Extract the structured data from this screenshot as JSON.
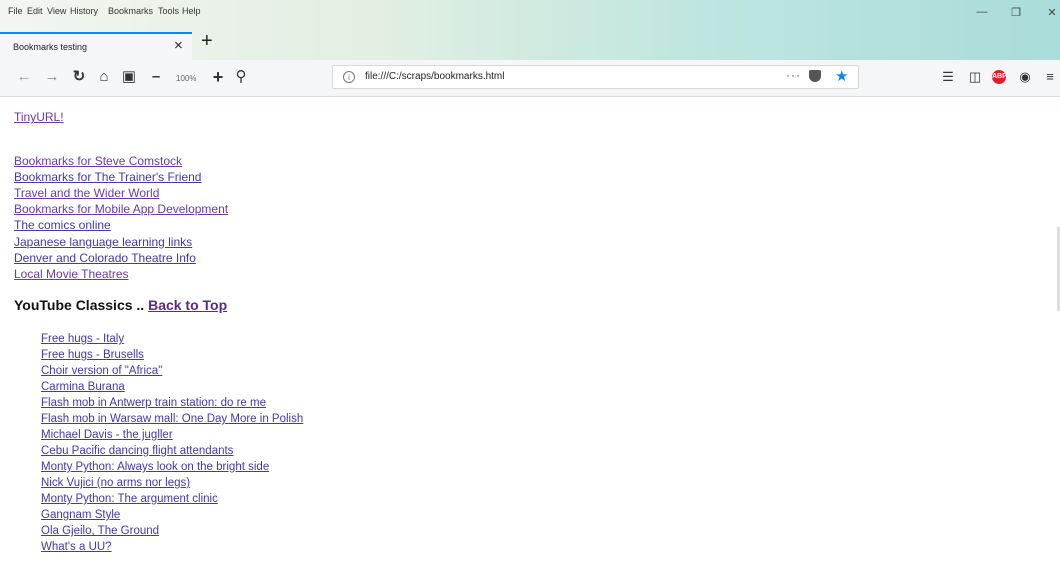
{
  "menu": [
    "File",
    "Edit",
    "View",
    "History",
    "Bookmarks",
    "Tools",
    "Help"
  ],
  "tab": {
    "title": "Bookmarks testing"
  },
  "nav": {
    "zoom": "100%",
    "url": "file:///C:/scraps/bookmarks.html",
    "more": "···"
  },
  "icons": {
    "back": "back-arrow-icon",
    "forward": "forward-arrow-icon",
    "reload": "reload-icon",
    "home": "home-icon",
    "screenshot": "screenshot-icon",
    "zoom_out": "zoom-out-icon",
    "zoom_in": "zoom-in-icon",
    "search": "search-icon",
    "library": "library-icon",
    "sidebar": "sidebar-icon",
    "abp": "adblock-icon",
    "addon": "addon-icon",
    "menu": "hamburger-menu-icon"
  },
  "colors": {
    "link": "#4338ad",
    "visited": "#6b3aa6",
    "star": "#0a84ff",
    "abp": "#e11d2b"
  },
  "page": {
    "tinyurl": "TinyURL!",
    "bookmark_links": [
      "Bookmarks for Steve Comstock",
      "Bookmarks for The Trainer's Friend",
      "Travel and the Wider World",
      "Bookmarks for Mobile App Development",
      "The comics online",
      "Japanese language learning links",
      "Denver and Colorado Theatre Info",
      "Local Movie Theatres"
    ],
    "section_title": "YouTube Classics ..",
    "back_to_top": "Back to Top",
    "youtube_links": [
      "Free hugs - Italy",
      "Free hugs - Brusells",
      "Choir version of \"Africa\"",
      "Carmina Burana",
      "Flash mob in Antwerp train station: do re me",
      "Flash mob in Warsaw mall: One Day More in Polish",
      "Michael Davis - the jugller",
      "Cebu Pacific dancing flight attendants",
      "Monty Python: Always look on the bright side",
      "Nick Vujici (no arms nor legs)",
      "Monty Python: The argument clinic",
      "Gangnam Style",
      "Ola Gjeilo, The Ground",
      "What's a UU?"
    ]
  }
}
